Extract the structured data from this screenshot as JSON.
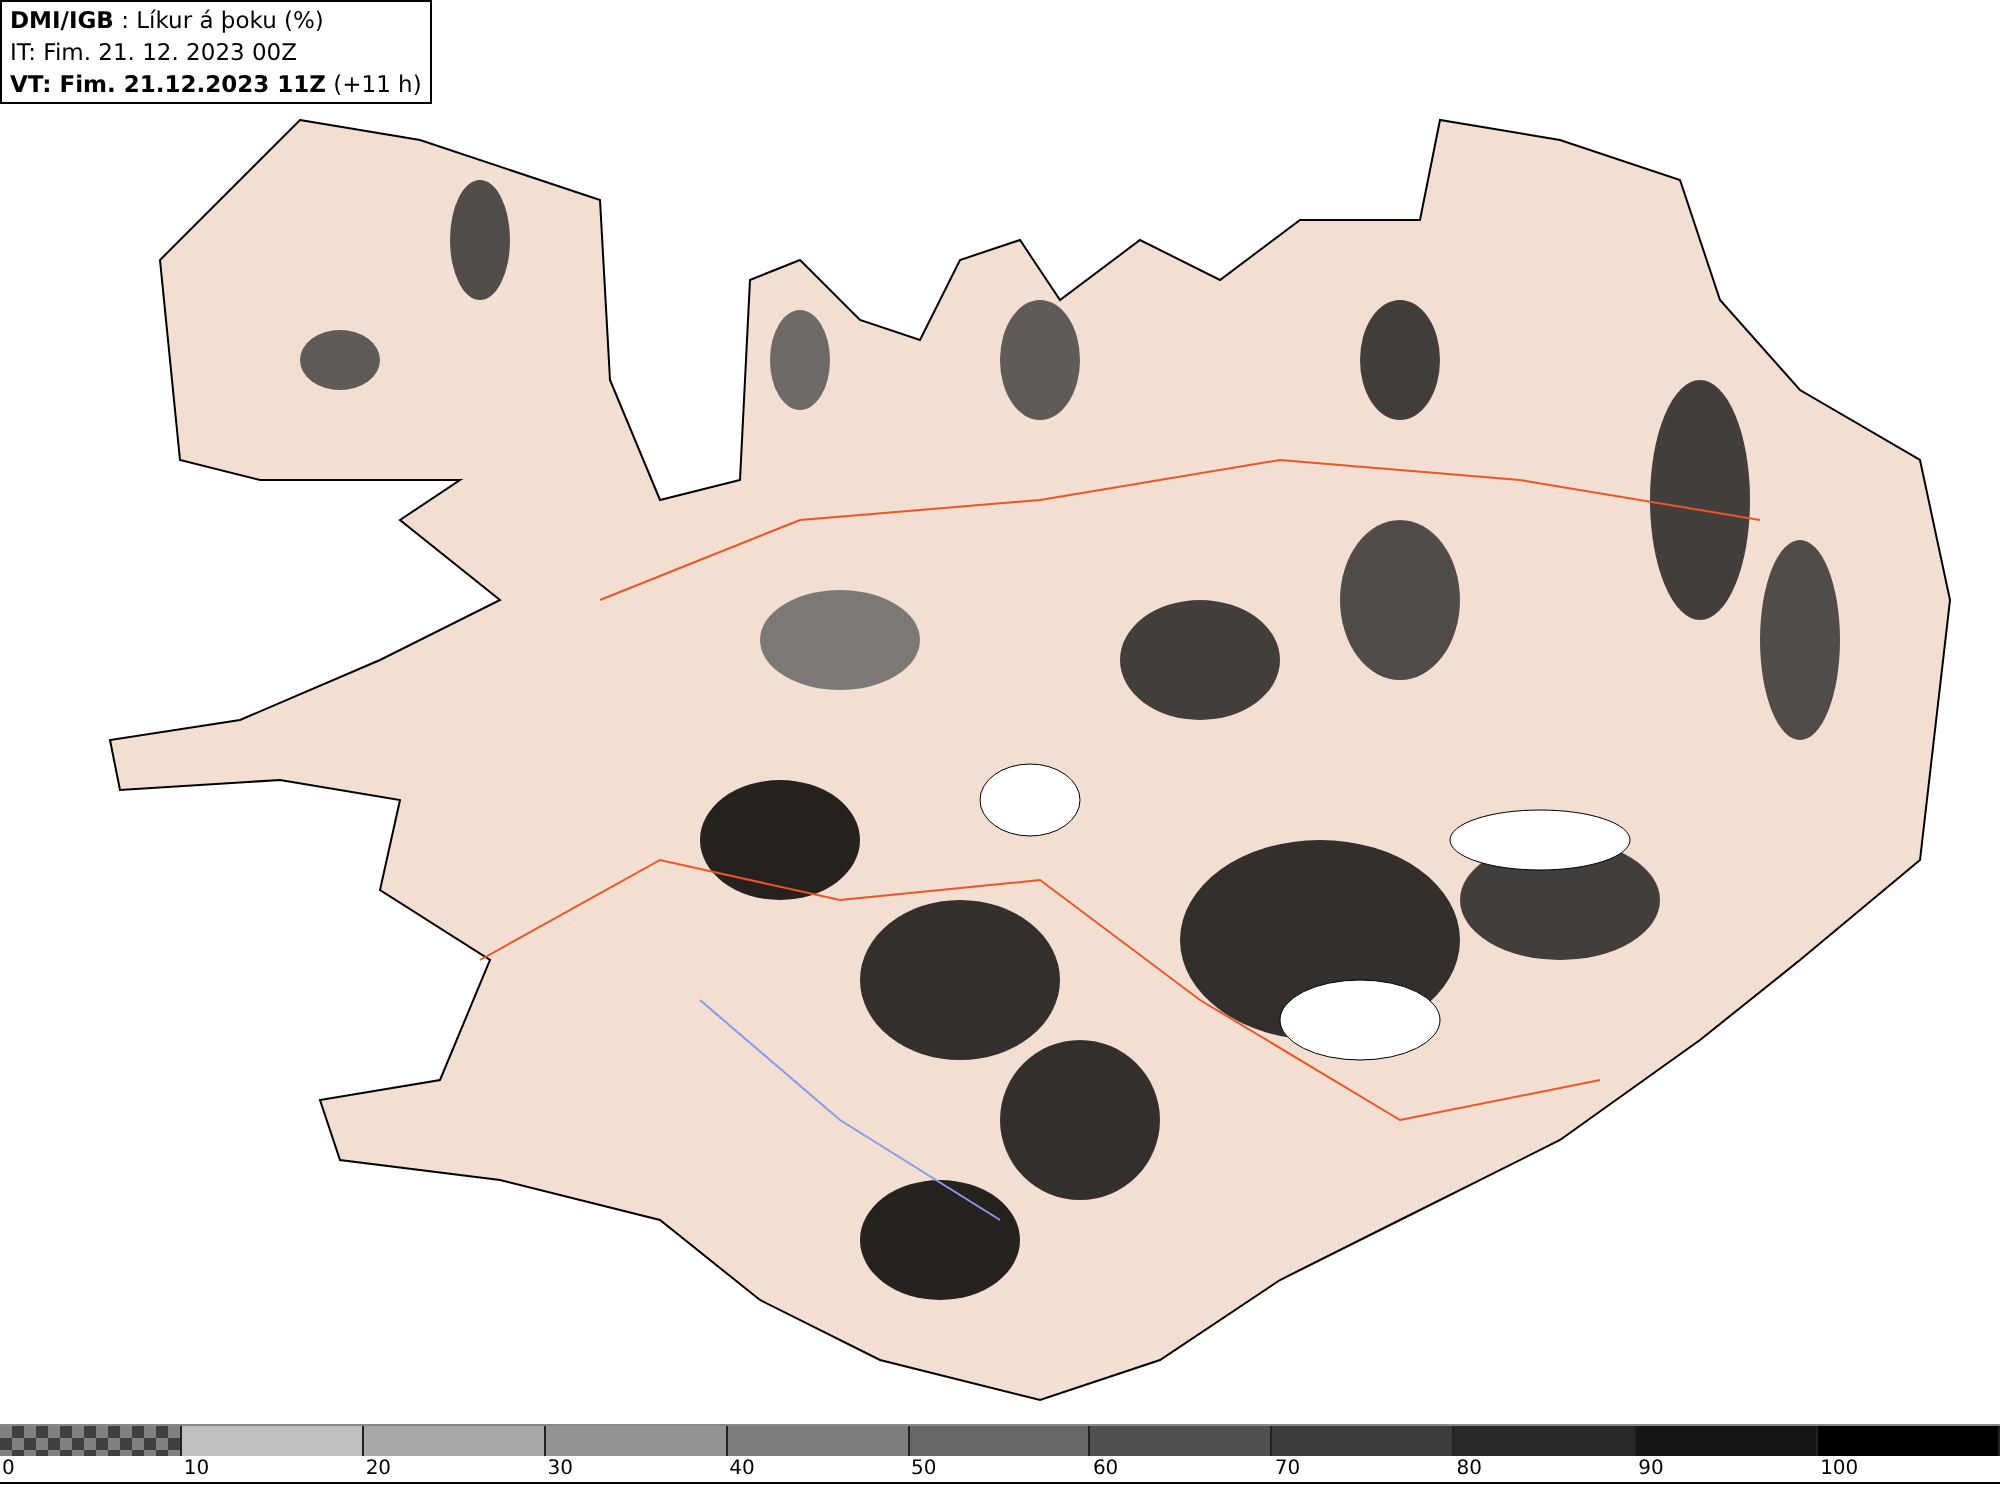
{
  "header": {
    "lines": [
      "**DMI/IGB** : Líkur á þoku (%)",
      "IT: Fim. 21. 12. 2023 00Z",
      "**VT: Fim. 21.12.2023 11Z** (+11 h)"
    ]
  },
  "legend": [
    {
      "kind": "checker",
      "color": "#808080",
      "label": "0"
    },
    {
      "kind": "solid",
      "color": "#bfbfbf",
      "label": "10"
    },
    {
      "kind": "solid",
      "color": "#a8a8a8",
      "label": "20"
    },
    {
      "kind": "solid",
      "color": "#939393",
      "label": "30"
    },
    {
      "kind": "solid",
      "color": "#7c7c7c",
      "label": "40"
    },
    {
      "kind": "solid",
      "color": "#666666",
      "label": "50"
    },
    {
      "kind": "solid",
      "color": "#505050",
      "label": "60"
    },
    {
      "kind": "solid",
      "color": "#3c3c3c",
      "label": "70"
    },
    {
      "kind": "solid",
      "color": "#282828",
      "label": "80"
    },
    {
      "kind": "solid",
      "color": "#151515",
      "label": "90"
    },
    {
      "kind": "solid",
      "color": "#000000",
      "label": "100"
    }
  ]
}
